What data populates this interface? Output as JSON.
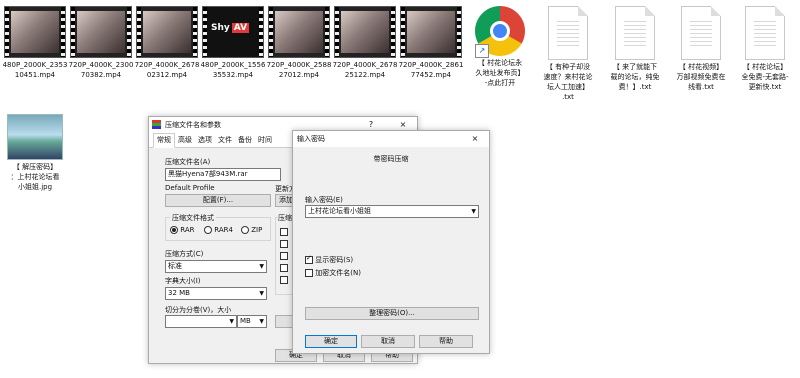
{
  "desktop": {
    "videos": [
      {
        "caption": "480P_2000K_2353\n10451.mp4"
      },
      {
        "caption": "720P_4000K_2300\n70382.mp4"
      },
      {
        "caption": "720P_4000K_2678\n02312.mp4"
      },
      {
        "caption": "480P_2000K_1556\n35532.mp4",
        "overlay": "Shy",
        "overlay_badge": "AV"
      },
      {
        "caption": "720P_4000K_2588\n27012.mp4"
      },
      {
        "caption": "720P_4000K_2678\n25122.mp4"
      },
      {
        "caption": "720P_4000K_2861\n77452.mp4"
      }
    ],
    "chrome": {
      "caption": "【 村花论坛永\n久地址发布页】\n-点此打开"
    },
    "texts": [
      {
        "caption": "【 有种子却没\n速度？来村花论\n坛人工加速】\n.txt"
      },
      {
        "caption": "【 来了就能下\n载的论坛，纯免\n费！】.txt"
      },
      {
        "caption": "【 村花视频】\n万部视频免费在\n线看.txt"
      },
      {
        "caption": "【 村花论坛】\n全免费-无套路-\n更新快.txt"
      }
    ],
    "image": {
      "caption": "【 解压密码】\n：上村花论坛看\n小姐姐.jpg"
    }
  },
  "archive_dialog": {
    "title": "压缩文件名和参数",
    "help": "?",
    "close": "×",
    "tabs": [
      "常规",
      "高级",
      "选项",
      "文件",
      "备份",
      "时间"
    ],
    "archive_name_label": "压缩文件名(A)",
    "archive_name_value": "黑猫Hyena7部943M.rar",
    "browse_label": "更新方",
    "profile_label": "Default Profile",
    "profile_button": "配置(F)...",
    "add_button": "添加",
    "format_label": "压缩文件格式",
    "formats": [
      "RAR",
      "RAR4",
      "ZIP"
    ],
    "options_label": "压缩",
    "method_label": "压缩方式(C)",
    "method_value": "标准",
    "dict_label": "字典大小(I)",
    "dict_value": "32 MB",
    "split_label": "切分为分卷(V)，大小",
    "split_unit": "MB",
    "ok": "确定",
    "cancel": "取消",
    "help_btn": "帮助"
  },
  "password_dialog": {
    "title": "输入密码",
    "close": "×",
    "heading": "带密码压缩",
    "prompt": "输入密码(E)",
    "password_value": "上村花论坛看小姐姐",
    "show_password": "显示密码(S)",
    "encrypt_names": "加密文件名(N)",
    "organize_button": "整理密码(O)...",
    "ok": "确定",
    "cancel": "取消",
    "help": "帮助"
  }
}
